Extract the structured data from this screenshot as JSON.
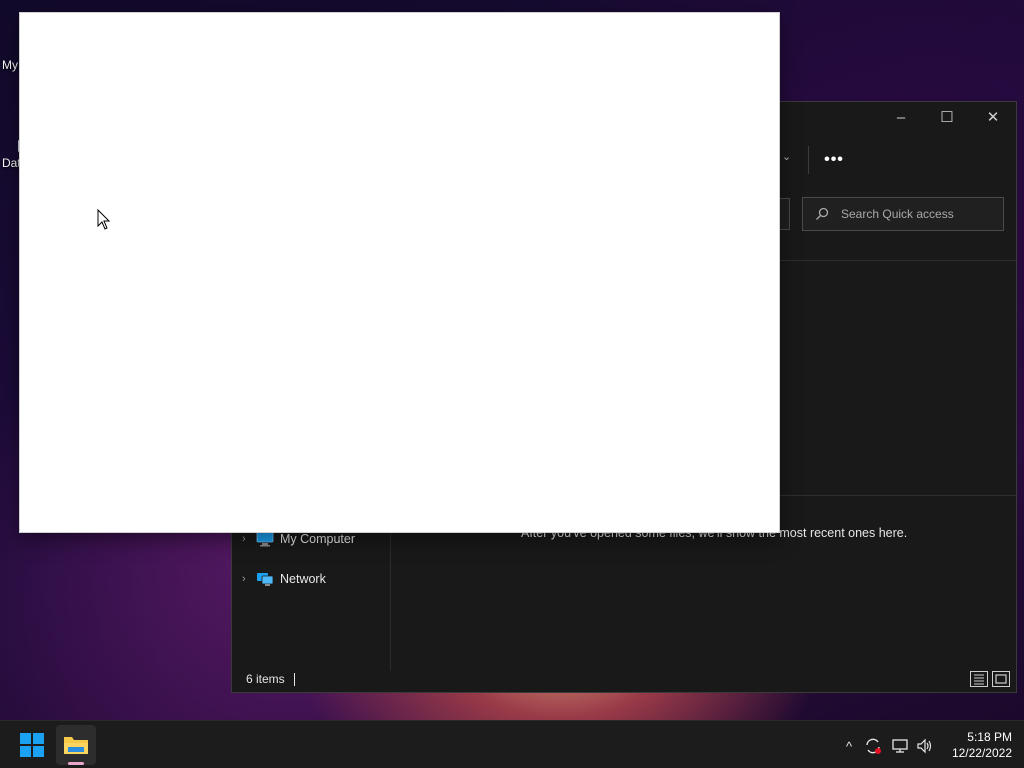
{
  "desktop": {
    "icons": [
      {
        "label": "My"
      },
      {
        "label": "Dat"
      }
    ]
  },
  "explorer": {
    "window_controls": {
      "minimize": "–",
      "maximize": "☐",
      "close": "✕"
    },
    "toolbar": {
      "more_label": "•••",
      "dropdown": "⌄"
    },
    "search": {
      "placeholder": "Search Quick access"
    },
    "nav_items": [
      {
        "label": "My Computer",
        "icon": "computer-icon"
      },
      {
        "label": "Network",
        "icon": "network-icon"
      }
    ],
    "empty_message": "After you've opened some files, we'll show the most recent ones here.",
    "status": {
      "item_count": "6 items"
    }
  },
  "taskbar": {
    "apps": [
      {
        "name": "start-button",
        "icon": "windows-logo-icon"
      },
      {
        "name": "file-explorer",
        "icon": "folder-icon",
        "active": true
      }
    ],
    "tray": {
      "chevron": "^",
      "clock_time": "5:18 PM",
      "clock_date": "12/22/2022"
    }
  },
  "colors": {
    "explorer_bg": "#191919",
    "taskbar_bg": "#1c1c1c",
    "accent_blue": "#1ba1f2",
    "folder_yellow": "#f7c948"
  }
}
